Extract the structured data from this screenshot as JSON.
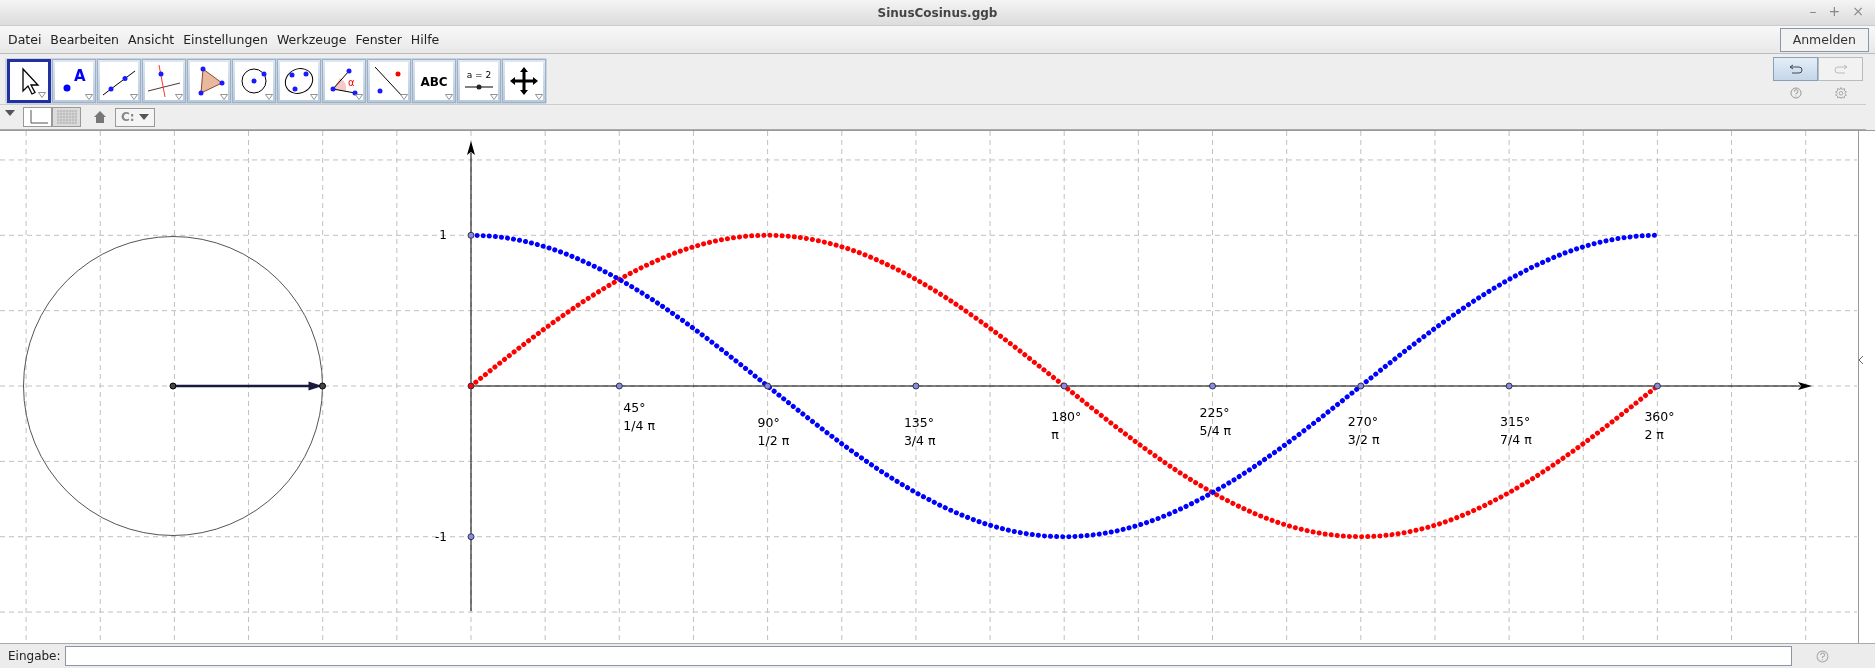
{
  "window": {
    "title": "SinusCosinus.ggb",
    "controls": [
      "–",
      "+",
      "×"
    ]
  },
  "menu": [
    "Datei",
    "Bearbeiten",
    "Ansicht",
    "Einstellungen",
    "Werkzeuge",
    "Fenster",
    "Hilfe"
  ],
  "login_button": "Anmelden",
  "tools": [
    {
      "kind": "move",
      "selected": true
    },
    {
      "kind": "point",
      "selected": false,
      "icon_text": "A"
    },
    {
      "kind": "line",
      "selected": false
    },
    {
      "kind": "perpendicular",
      "selected": false
    },
    {
      "kind": "polygon",
      "selected": false
    },
    {
      "kind": "circle",
      "selected": false
    },
    {
      "kind": "conic",
      "selected": false
    },
    {
      "kind": "angle",
      "selected": false,
      "icon_text": "α"
    },
    {
      "kind": "reflect",
      "selected": false
    },
    {
      "kind": "text",
      "selected": false,
      "icon_text": "ABC"
    },
    {
      "kind": "slider",
      "selected": false,
      "icon_text": "a = 2"
    },
    {
      "kind": "pan",
      "selected": false
    }
  ],
  "undo": {
    "disabled": false
  },
  "redo": {
    "disabled": true
  },
  "style_bar": {
    "axes": {
      "on": false
    },
    "grid": {
      "on": true
    },
    "capture": "C:"
  },
  "graphics": {
    "y_labels": [
      "1",
      "-1"
    ],
    "x_marks": [
      {
        "degrees": "45°",
        "radians": "1/4 π"
      },
      {
        "degrees": "90°",
        "radians": "1/2 π"
      },
      {
        "degrees": "135°",
        "radians": "3/4 π"
      },
      {
        "degrees": "180°",
        "radians": "π"
      },
      {
        "degrees": "225°",
        "radians": "5/4 π"
      },
      {
        "degrees": "270°",
        "radians": "3/2 π"
      },
      {
        "degrees": "315°",
        "radians": "7/4 π"
      },
      {
        "degrees": "360°",
        "radians": "2 π"
      }
    ]
  },
  "input_bar": {
    "label": "Eingabe:"
  }
}
